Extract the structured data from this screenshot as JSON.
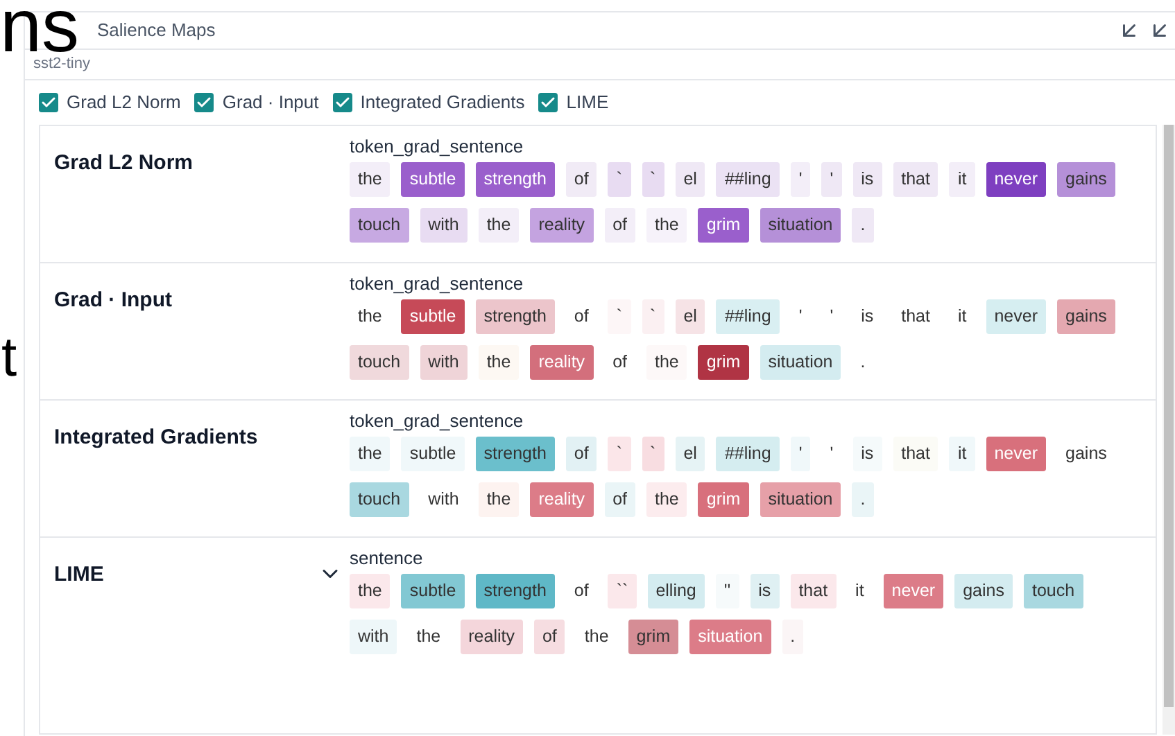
{
  "slide_fragments": [
    {
      "text": "ns"
    },
    {
      "text": "t"
    }
  ],
  "panel": {
    "title": "Salience Maps",
    "subtitle": "sst2-tiny"
  },
  "methods": [
    {
      "label": "Grad L2 Norm",
      "checked": true
    },
    {
      "label": "Grad · Input",
      "checked": true
    },
    {
      "label": "Integrated Gradients",
      "checked": true
    },
    {
      "label": "LIME",
      "checked": true
    }
  ],
  "rows": [
    {
      "method": "Grad L2 Norm",
      "field": "token_grad_sentence",
      "collapsible": false,
      "tokens": [
        {
          "text": "the",
          "color": "#f3eef8"
        },
        {
          "text": "subtle",
          "color": "#9a5fcc"
        },
        {
          "text": "strength",
          "color": "#9a5fcc"
        },
        {
          "text": "of",
          "color": "#f1ebf6"
        },
        {
          "text": "`",
          "color": "#e8dcf2"
        },
        {
          "text": "`",
          "color": "#e8dcf2"
        },
        {
          "text": "el",
          "color": "#efe8f5"
        },
        {
          "text": "##ling",
          "color": "#ebe2f4"
        },
        {
          "text": "'",
          "color": "#f3eef8"
        },
        {
          "text": "'",
          "color": "#efe8f5"
        },
        {
          "text": "is",
          "color": "#efe8f5"
        },
        {
          "text": "that",
          "color": "#efe8f5"
        },
        {
          "text": "it",
          "color": "#f3eef8"
        },
        {
          "text": "never",
          "color": "#7e3fc0"
        },
        {
          "text": "gains",
          "color": "#b590d8"
        },
        {
          "text": "touch",
          "color": "#c7a9e2"
        },
        {
          "text": "with",
          "color": "#e8dcf2"
        },
        {
          "text": "the",
          "color": "#f3eef8"
        },
        {
          "text": "reality",
          "color": "#c4a3e0"
        },
        {
          "text": "of",
          "color": "#f3eef8"
        },
        {
          "text": "the",
          "color": "#f6f2fa"
        },
        {
          "text": "grim",
          "color": "#9a5fcc"
        },
        {
          "text": "situation",
          "color": "#b590d8"
        },
        {
          "text": ".",
          "color": "#efe8f5"
        }
      ]
    },
    {
      "method": "Grad · Input",
      "field": "token_grad_sentence",
      "collapsible": false,
      "tokens": [
        {
          "text": "the",
          "color": "#ffffff"
        },
        {
          "text": "subtle",
          "color": "#c64a58"
        },
        {
          "text": "strength",
          "color": "#ecc5cb"
        },
        {
          "text": "of",
          "color": "#ffffff"
        },
        {
          "text": "`",
          "color": "#fdf6f7"
        },
        {
          "text": "`",
          "color": "#fbf0f2"
        },
        {
          "text": "el",
          "color": "#f6e3e6"
        },
        {
          "text": "##ling",
          "color": "#d9eff2"
        },
        {
          "text": "'",
          "color": "#ffffff"
        },
        {
          "text": "'",
          "color": "#ffffff"
        },
        {
          "text": "is",
          "color": "#ffffff"
        },
        {
          "text": "that",
          "color": "#ffffff"
        },
        {
          "text": "it",
          "color": "#ffffff"
        },
        {
          "text": "never",
          "color": "#d6eef1"
        },
        {
          "text": "gains",
          "color": "#e4a8b0"
        },
        {
          "text": "touch",
          "color": "#f0d9dc"
        },
        {
          "text": "with",
          "color": "#efd4d8"
        },
        {
          "text": "the",
          "color": "#fdf8f3"
        },
        {
          "text": "reality",
          "color": "#d36f7c"
        },
        {
          "text": "of",
          "color": "#ffffff"
        },
        {
          "text": "the",
          "color": "#fdf8f8"
        },
        {
          "text": "grim",
          "color": "#b03444"
        },
        {
          "text": "situation",
          "color": "#d4ecf0"
        },
        {
          "text": ".",
          "color": "#ffffff"
        }
      ]
    },
    {
      "method": "Integrated Gradients",
      "field": "token_grad_sentence",
      "collapsible": false,
      "tokens": [
        {
          "text": "the",
          "color": "#f0f8fa"
        },
        {
          "text": "subtle",
          "color": "#f0f8fa"
        },
        {
          "text": "strength",
          "color": "#6bbfcc"
        },
        {
          "text": "of",
          "color": "#e2f1f4"
        },
        {
          "text": "`",
          "color": "#fbe6e9"
        },
        {
          "text": "`",
          "color": "#f8dde1"
        },
        {
          "text": "el",
          "color": "#e6f3f5"
        },
        {
          "text": "##ling",
          "color": "#d5edf0"
        },
        {
          "text": "'",
          "color": "#f0f8fa"
        },
        {
          "text": "'",
          "color": "#ffffff"
        },
        {
          "text": "is",
          "color": "#f5fafb"
        },
        {
          "text": "that",
          "color": "#fbfbf6"
        },
        {
          "text": "it",
          "color": "#f0f8fa"
        },
        {
          "text": "never",
          "color": "#d8707c"
        },
        {
          "text": "gains",
          "color": "#ffffff"
        },
        {
          "text": "touch",
          "color": "#a9d8e0"
        },
        {
          "text": "with",
          "color": "#ffffff"
        },
        {
          "text": "the",
          "color": "#fdf3f0"
        },
        {
          "text": "reality",
          "color": "#dc7c88"
        },
        {
          "text": "of",
          "color": "#eaf5f7"
        },
        {
          "text": "the",
          "color": "#fcecee"
        },
        {
          "text": "grim",
          "color": "#d8707c"
        },
        {
          "text": "situation",
          "color": "#e6a0a8"
        },
        {
          "text": ".",
          "color": "#eaf5f7"
        }
      ]
    },
    {
      "method": "LIME",
      "field": "sentence",
      "collapsible": true,
      "tokens": [
        {
          "text": "the",
          "color": "#fbe8eb"
        },
        {
          "text": "subtle",
          "color": "#82c8d3"
        },
        {
          "text": "strength",
          "color": "#5fb8c7"
        },
        {
          "text": "of",
          "color": "#ffffff"
        },
        {
          "text": "``",
          "color": "#fbe8eb"
        },
        {
          "text": "elling",
          "color": "#d4ecf0"
        },
        {
          "text": "''",
          "color": "#f6fafb"
        },
        {
          "text": "is",
          "color": "#dff0f3"
        },
        {
          "text": "that",
          "color": "#fbe8eb"
        },
        {
          "text": "it",
          "color": "#ffffff"
        },
        {
          "text": "never",
          "color": "#dc7c88"
        },
        {
          "text": "gains",
          "color": "#d4ecf0"
        },
        {
          "text": "touch",
          "color": "#a9d8e0"
        },
        {
          "text": "with",
          "color": "#eef7f9"
        },
        {
          "text": "the",
          "color": "#ffffff"
        },
        {
          "text": "reality",
          "color": "#f4d6db"
        },
        {
          "text": "of",
          "color": "#f6dde1"
        },
        {
          "text": "the",
          "color": "#ffffff"
        },
        {
          "text": "grim",
          "color": "#d58d95"
        },
        {
          "text": "situation",
          "color": "#dc7c88"
        },
        {
          "text": ".",
          "color": "#fbf5f6"
        }
      ]
    }
  ]
}
